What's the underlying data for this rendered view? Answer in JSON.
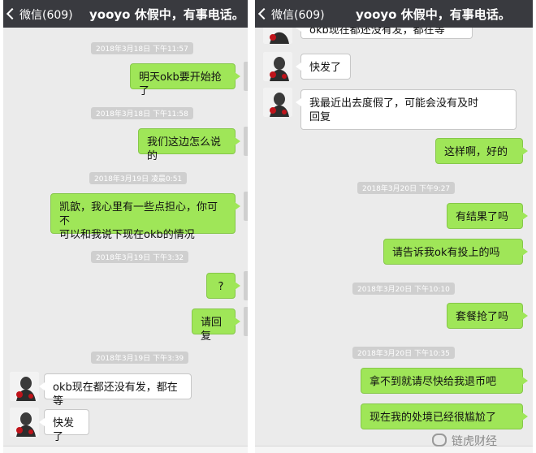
{
  "left": {
    "back_label": "微信(609)",
    "title": "yooyo 休假中，有事电话。",
    "items": [
      {
        "time": "2018年3月18日 下午11:57",
        "text": "明天okb要开始抢了"
      },
      {
        "time": "2018年3月18日 下午11:58",
        "text": "我们这边怎么说的"
      },
      {
        "time": "2018年3月19日 凌晨0:51",
        "text_l1": "凯歆，我心里有一些点担心，你可不",
        "text_l2": "可以和我说下现在okb的情况"
      },
      {
        "time": "2018年3月19日 下午3:32",
        "text": "?"
      },
      {
        "text": "请回复"
      },
      {
        "time": "2018年3月19日 下午3:39",
        "text": "okb现在都还没有发，都在等"
      },
      {
        "text": "快发了"
      }
    ]
  },
  "right": {
    "back_label": "微信(609)",
    "title": "yooyo 休假中，有事电话。",
    "partial_text": "okb现在都还没有发，都在等",
    "items": [
      {
        "text": "快发了"
      },
      {
        "text_l1": "我最近出去度假了，可能会没有及时",
        "text_l2": "回复"
      },
      {
        "text": "这样啊，好的"
      },
      {
        "time": "2018年3月20日 下午9:27",
        "text": "有结果了吗"
      },
      {
        "text": "请告诉我ok有投上的吗"
      },
      {
        "time": "2018年3月20日 下午10:10",
        "text": "套餐抢了吗"
      },
      {
        "time": "2018年3月20日 下午10:35",
        "text": "拿不到就请尽快给我退币吧"
      },
      {
        "text": "现在我的处境已经很尴尬了"
      }
    ]
  },
  "watermark": "链虎财经"
}
